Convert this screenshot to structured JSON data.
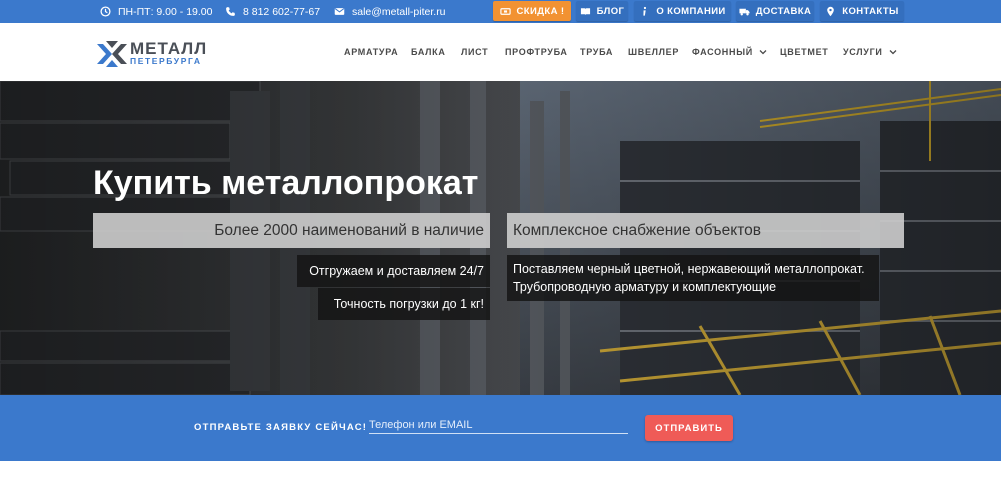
{
  "topbar": {
    "hours": {
      "icon": "clock-icon",
      "text": "ПН-ПТ: 9.00 - 19.00"
    },
    "phone": {
      "icon": "phone-icon",
      "text": "8 812 602-77-67"
    },
    "email": {
      "icon": "envelope-icon",
      "text": "sale@metall-piter.ru"
    },
    "buttons": [
      {
        "icon": "ticket-icon",
        "label": "Скидка !"
      },
      {
        "icon": "book-icon",
        "label": "Блог"
      },
      {
        "icon": "info-icon",
        "label": "О компании"
      },
      {
        "icon": "truck-icon",
        "label": "Доставка"
      },
      {
        "icon": "map-pin-icon",
        "label": "Контакты"
      }
    ]
  },
  "logo": {
    "line1": "МЕТАЛЛ",
    "line2": "ПЕТЕРБУРГА"
  },
  "nav": {
    "items": [
      {
        "label": "Арматура"
      },
      {
        "label": "Балка"
      },
      {
        "label": "Лист"
      },
      {
        "label": "Профтруба"
      },
      {
        "label": "Труба"
      },
      {
        "label": "Швеллер"
      },
      {
        "label": "Фасонный",
        "dropdown": true
      },
      {
        "label": "Цветмет"
      },
      {
        "label": "Услуги",
        "dropdown": true
      }
    ]
  },
  "hero": {
    "title": "Купить металлопрокат",
    "left": {
      "heading": "Более 2000 наименований в наличие",
      "line1": "Отгружаем и доставляем 24/7",
      "line2": "Точность погрузки до 1 кг!"
    },
    "right": {
      "heading": "Комплексное снабжение объектов",
      "line1": "Поставляем черный цветной, нержавеющий металлопрокат.",
      "line2": "Трубопроводную арматуру и комплектующие"
    }
  },
  "request": {
    "label": "Отправьте заявку сейчас!",
    "placeholder": "Телефон или EMAIL",
    "value": "",
    "button": "Отправить"
  },
  "colors": {
    "brand_blue": "#3b79cc",
    "accent_orange": "#f29232",
    "submit_red": "#ef5b57"
  }
}
